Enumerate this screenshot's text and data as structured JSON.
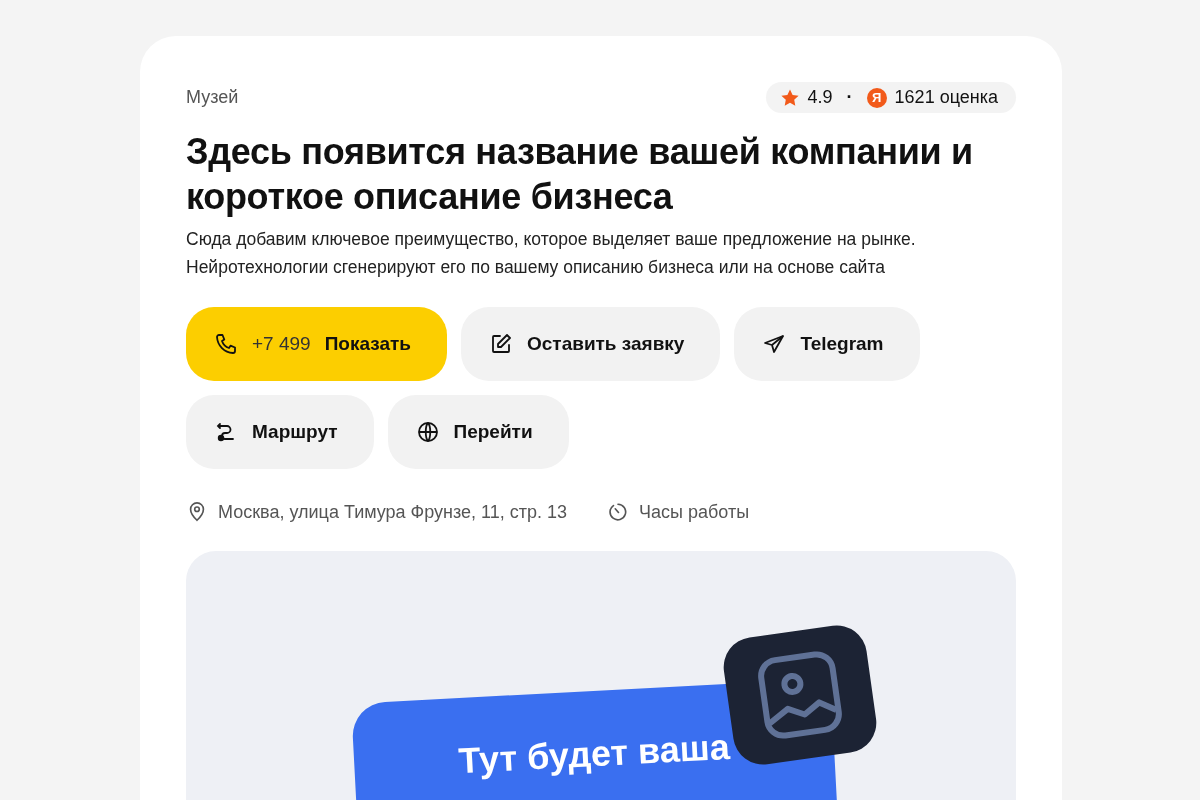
{
  "category": "Музей",
  "rating": {
    "score": "4.9",
    "separator": "·",
    "source_letter": "Я",
    "reviews": "1621 оценка"
  },
  "title": "Здесь появится название вашей компании и короткое описание бизнеса",
  "description": "Сюда добавим ключевое преимущество, которое выделяет ваше предложение на рынке. Нейротехнологии сгенерируют его по вашему описанию бизнеса или на основе сайта",
  "actions": [
    {
      "kind": "phone",
      "number": "+7 499",
      "label": "Показать",
      "primary": true
    },
    {
      "kind": "form",
      "label": "Оставить заявку",
      "primary": false
    },
    {
      "kind": "telegram",
      "label": "Telegram",
      "primary": false
    },
    {
      "kind": "route",
      "label": "Маршрут",
      "primary": false
    },
    {
      "kind": "website",
      "label": "Перейти",
      "primary": false
    }
  ],
  "info": [
    {
      "kind": "address",
      "text": "Москва, улица Тимура Фрунзе, 11, стр. 13"
    },
    {
      "kind": "hours",
      "text": "Часы работы"
    }
  ],
  "preview": {
    "caption": "Тут будет ваша"
  }
}
